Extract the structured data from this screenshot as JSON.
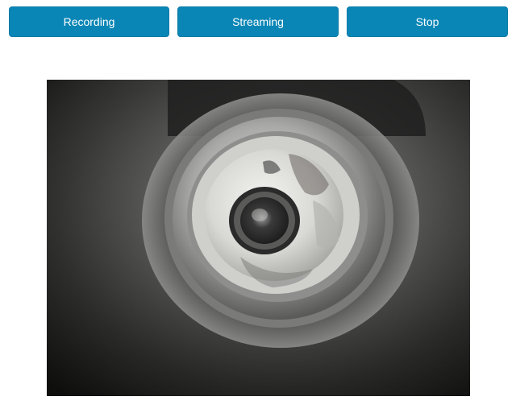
{
  "toolbar": {
    "recording_label": "Recording",
    "streaming_label": "Streaming",
    "stop_label": "Stop"
  },
  "video": {
    "icon": "camera-feed-image"
  },
  "colors": {
    "button_bg": "#0a86b6",
    "button_text": "#ffffff",
    "page_bg": "#ffffff"
  }
}
